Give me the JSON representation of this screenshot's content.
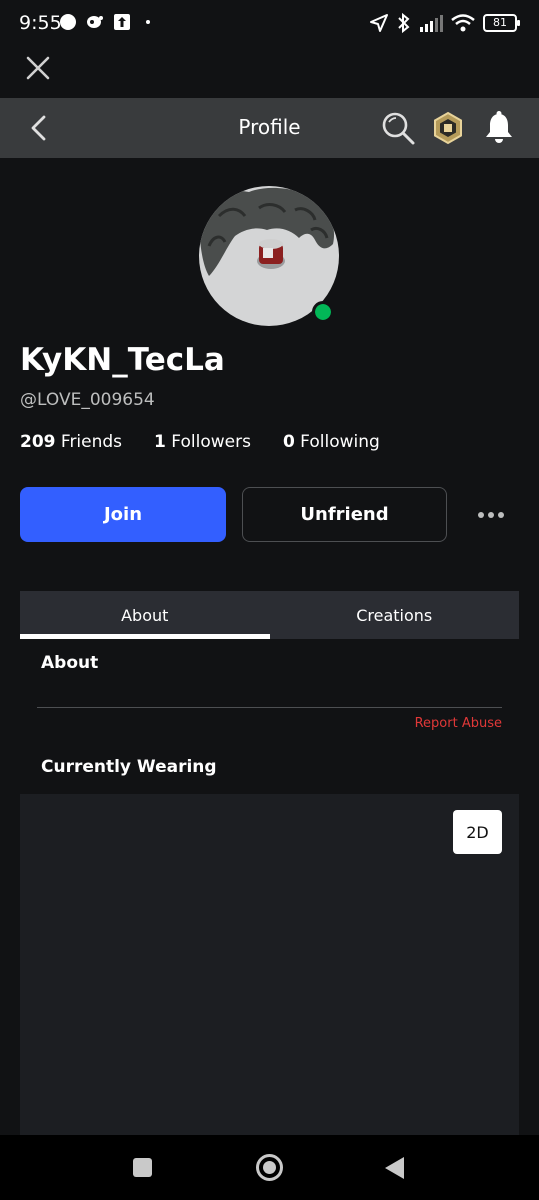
{
  "status_bar": {
    "time": "9:55",
    "battery": "81"
  },
  "header": {
    "title": "Profile"
  },
  "profile": {
    "display_name": "KyKN_TecLa",
    "username": "@LOVE_009654",
    "stats": [
      {
        "count": "209",
        "label": " Friends"
      },
      {
        "count": "1",
        "label": " Followers"
      },
      {
        "count": "0",
        "label": " Following"
      }
    ]
  },
  "actions": {
    "join": "Join",
    "unfriend": "Unfriend"
  },
  "tabs": [
    {
      "label": "About",
      "active": true
    },
    {
      "label": "Creations",
      "active": false
    }
  ],
  "about": {
    "heading": "About",
    "report": "Report Abuse",
    "wearing_heading": "Currently Wearing",
    "toggle_2d": "2D"
  },
  "colors": {
    "background": "#111214",
    "header": "#393b3d",
    "join": "#335fff",
    "online": "#02b757",
    "report": "#e03838"
  }
}
